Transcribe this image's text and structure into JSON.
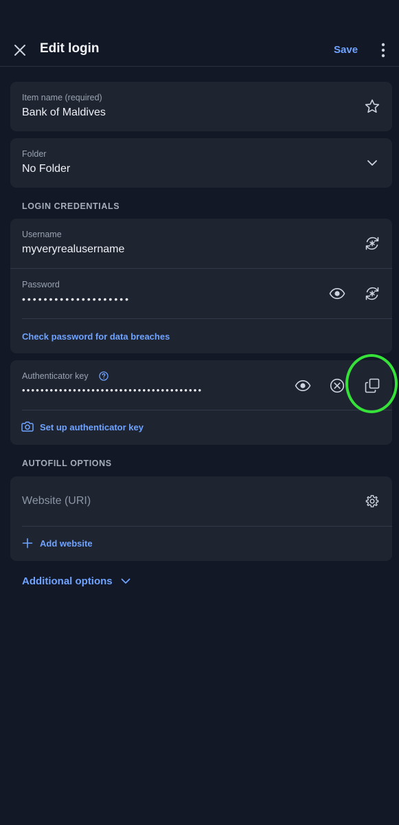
{
  "header": {
    "title": "Edit login",
    "save_label": "Save"
  },
  "item": {
    "name_label": "Item name (required)",
    "name_value": "Bank of Maldives",
    "folder_label": "Folder",
    "folder_value": "No Folder"
  },
  "login": {
    "section_title": "LOGIN CREDENTIALS",
    "username_label": "Username",
    "username_value": "myveryrealusername",
    "password_label": "Password",
    "password_value": "••••••••••••••••••••",
    "check_breaches_label": "Check password for data breaches"
  },
  "authenticator": {
    "label": "Authenticator key",
    "value": "•••••••••••••••••••••••••••••••••••••••",
    "setup_label": "Set up authenticator key"
  },
  "autofill": {
    "section_title": "AUTOFILL OPTIONS",
    "website_placeholder": "Website (URI)",
    "add_website_label": "Add website"
  },
  "additional": {
    "label": "Additional options"
  },
  "colors": {
    "background": "#121826",
    "card": "#1e2430",
    "accent": "#6fa3ff",
    "highlight": "#36e23a"
  }
}
